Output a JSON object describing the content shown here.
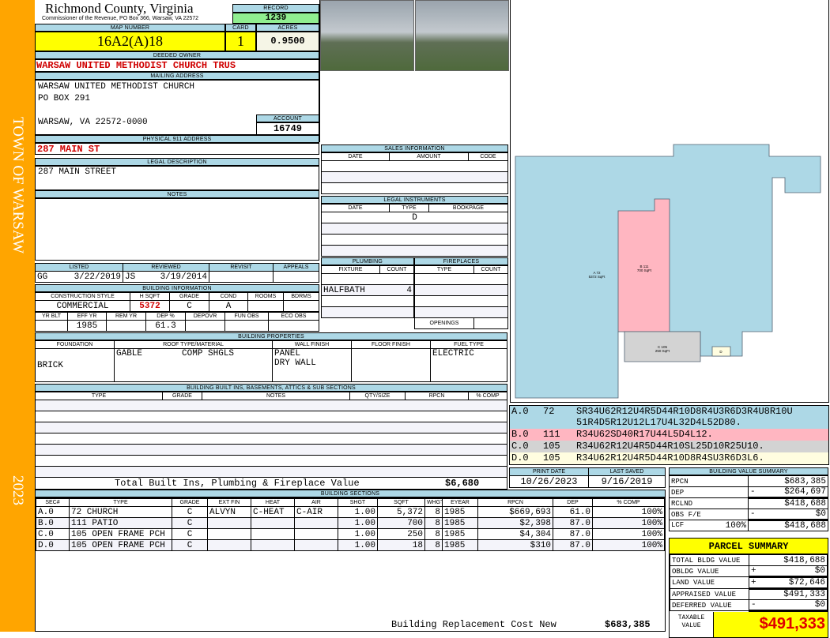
{
  "side": {
    "town": "TOWN OF WARSAW",
    "year": "2023"
  },
  "header": {
    "title": "Richmond County, Virginia",
    "subtitle": "Commissioner of the Revenue, PO Box 366, Warsaw, VA 22572",
    "record_label": "RECORD",
    "record": "1239"
  },
  "parcel": {
    "map_label": "MAP NUMBER",
    "map": "16A2(A)18",
    "card_label": "CARD",
    "card": "1",
    "acres_label": "ACRES",
    "acres": "0.9500"
  },
  "owner": {
    "label": "DEEDED OWNER",
    "value": "WARSAW UNITED METHODIST CHURCH TRUS"
  },
  "mailing": {
    "label": "MAILING ADDRESS",
    "lines": [
      "WARSAW UNITED METHODIST CHURCH",
      "PO BOX 291",
      "WARSAW, VA 22572-0000"
    ],
    "account_label": "ACCOUNT",
    "account": "16749"
  },
  "physical": {
    "label": "PHYSICAL 911 ADDRESS",
    "value": "287 MAIN ST"
  },
  "legal": {
    "label": "LEGAL DESCRIPTION",
    "value": "287 MAIN STREET"
  },
  "notes": {
    "label": "NOTES"
  },
  "review": {
    "headers": [
      "LISTED",
      "REVIEWED",
      "REVISIT",
      "APPEALS"
    ],
    "listed_by": "GG",
    "listed": "3/22/2019",
    "reviewed_by": "JS",
    "reviewed": "3/19/2014"
  },
  "bldg_info": {
    "label": "BUILDING INFORMATION",
    "h1": [
      "CONSTRUCTION STYLE",
      "H SQFT",
      "GRADE",
      "COND",
      "ROOMS",
      "BDRMS"
    ],
    "v1": [
      "COMMERCIAL",
      "5372",
      "C",
      "A",
      "",
      ""
    ],
    "h2": [
      "YR BLT",
      "EFF YR",
      "REM YR",
      "DEP %",
      "DEPOVR",
      "FUN OBS",
      "ECO OBS"
    ],
    "v2": [
      "",
      "1985",
      "",
      "61.3",
      "",
      "",
      ""
    ]
  },
  "bldg_props": {
    "label": "BUILDING PROPERTIES",
    "headers": [
      "FOUNDATION",
      "ROOF TYPE/MATERIAL",
      "WALL FINISH",
      "FLOOR FINISH",
      "FUEL TYPE"
    ],
    "foundation": "BRICK",
    "roof_type": "GABLE",
    "roof_material": "COMP SHGLS",
    "wall1": "PANEL",
    "wall2": "DRY WALL",
    "fuel": "ELECTRIC"
  },
  "builtins": {
    "label": "BUILDING BUILT INS, BASEMENTS, ATTICS & SUB SECTIONS",
    "headers": [
      "TYPE",
      "GRADE",
      "NOTES",
      "QTY/SIZE",
      "RPCN",
      "% COMP"
    ],
    "total_label": "Total Built Ins, Plumbing & Fireplace Value",
    "total": "$6,680"
  },
  "sales": {
    "label": "SALES INFORMATION",
    "headers": [
      "DATE",
      "AMOUNT",
      "CODE"
    ]
  },
  "legal_instr": {
    "label": "LEGAL INSTRUMENTS",
    "headers": [
      "DATE",
      "TYPE",
      "BOOKPAGE"
    ],
    "rows": [
      [
        "",
        "D",
        ""
      ]
    ]
  },
  "plumbing": {
    "label": "PLUMBING",
    "headers": [
      "FIXTURE",
      "COUNT"
    ],
    "fixture": "HALFBATH",
    "count": "4"
  },
  "fireplaces": {
    "label": "FIREPLACES",
    "headers": [
      "TYPE",
      "COUNT"
    ],
    "openings": "OPENINGS"
  },
  "sketch": {
    "a_label": "A 72",
    "a_area": "5372 SqFt",
    "b_label": "B 111",
    "b_area": "700 SqFt",
    "c_label": "C 105",
    "c_area": "250 SqFt",
    "d_label": "D"
  },
  "sketch_legend": [
    {
      "sec": "A.0",
      "code": "72",
      "path": "SR34U62R12U4R5D44R10D8R4U3R6D3R4U8R10U",
      "path2": "51R4D5R12U12L17U4L32D4L52D80.",
      "color": "#add8e6"
    },
    {
      "sec": "B.0",
      "code": "111",
      "path": "R34U62SD40R17U44L5D4L12.",
      "color": "#ffb6c1"
    },
    {
      "sec": "C.0",
      "code": "105",
      "path": "R34U62R12U4R5D44R10SL25D10R25U10.",
      "color": "#d3d3d3"
    },
    {
      "sec": "D.0",
      "code": "105",
      "path": "R34U62R12U4R5D44R10D8R4SU3R6D3L6.",
      "color": "#fffde0"
    }
  ],
  "dates": {
    "print_label": "PRINT DATE",
    "print": "10/26/2023",
    "saved_label": "LAST SAVED",
    "saved": "9/16/2019"
  },
  "bvs": {
    "label": "BUILDING VALUE SUMMARY",
    "rows": [
      {
        "k": "RPCN",
        "s": "",
        "v": "$683,385"
      },
      {
        "k": "DEP",
        "s": "-",
        "v": "$264,697"
      },
      {
        "k": "RCLND",
        "s": "",
        "v": "$418,688"
      },
      {
        "k": "OBS F/E",
        "s": "-",
        "v": "$0"
      },
      {
        "k": "LCF",
        "pct": "100%",
        "s": "",
        "v": "$418,688"
      }
    ]
  },
  "parcel_summary": {
    "label": "PARCEL SUMMARY",
    "rows": [
      {
        "k": "TOTAL BLDG VALUE",
        "s": "",
        "v": "$418,688"
      },
      {
        "k": "OBLDG VALUE",
        "s": "+",
        "v": "$0"
      },
      {
        "k": "LAND VALUE",
        "s": "+",
        "v": "$72,646"
      },
      {
        "k": "APPRAISED VALUE",
        "s": "",
        "v": "$491,333"
      },
      {
        "k": "DEFERRED VALUE",
        "s": "-",
        "v": "$0"
      }
    ],
    "taxable_label": "TAXABLE VALUE",
    "taxable": "$491,333"
  },
  "sections": {
    "label": "BUILDING SECTIONS",
    "headers": [
      "SEC#",
      "TYPE",
      "GRADE",
      "EXT FIN",
      "HEAT",
      "AIR",
      "SHGT",
      "SQFT",
      "WHGT",
      "EYEAR",
      "RPCN",
      "DEP",
      "% COMP"
    ],
    "rows": [
      [
        "A.0",
        "72 CHURCH",
        "C",
        "ALVYN",
        "C-HEAT",
        "C-AIR",
        "1.00",
        "5,372",
        "8",
        "1985",
        "$669,693",
        "61.0",
        "100%"
      ],
      [
        "B.0",
        "111 PATIO",
        "C",
        "",
        "",
        "",
        "1.00",
        "700",
        "8",
        "1985",
        "$2,398",
        "87.0",
        "100%"
      ],
      [
        "C.0",
        "105 OPEN FRAME PCH",
        "C",
        "",
        "",
        "",
        "1.00",
        "250",
        "8",
        "1985",
        "$4,304",
        "87.0",
        "100%"
      ],
      [
        "D.0",
        "105 OPEN FRAME PCH",
        "C",
        "",
        "",
        "",
        "1.00",
        "18",
        "8",
        "1985",
        "$310",
        "87.0",
        "100%"
      ]
    ],
    "total_label": "Building Replacement Cost New",
    "total": "$683,385"
  }
}
